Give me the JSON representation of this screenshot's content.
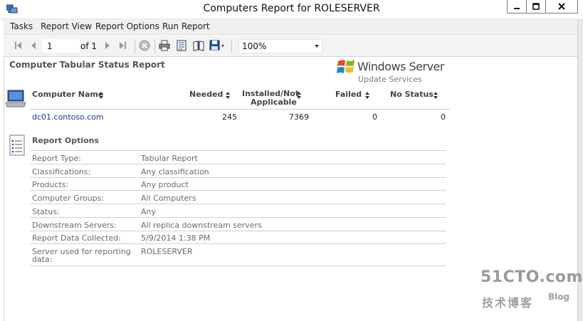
{
  "window": {
    "title": "Computers Report for ROLESERVER"
  },
  "menu": [
    "Tasks",
    "Report View",
    "Report Options",
    "Run Report"
  ],
  "toolbar": {
    "page_value": "1",
    "of_label": "of 1",
    "zoom": "100%"
  },
  "report": {
    "title": "Computer Tabular Status Report",
    "logo_line1": "Windows Server",
    "logo_line2": "Update Services",
    "columns": {
      "computer_name": "Computer Name",
      "needed": "Needed",
      "installed_line1": "Installed/Not",
      "installed_line2": "Applicable",
      "failed": "Failed",
      "no_status": "No Status"
    },
    "rows": [
      {
        "computer": "dc01.contoso.com",
        "needed": "245",
        "installed": "7369",
        "failed": "0",
        "no_status": "0"
      }
    ]
  },
  "options": {
    "title": "Report Options",
    "items": [
      {
        "label": "Report Type:",
        "value": "Tabular Report"
      },
      {
        "label": "Classifications:",
        "value": "Any classification"
      },
      {
        "label": "Products:",
        "value": "Any product"
      },
      {
        "label": "Computer Groups:",
        "value": "All Computers"
      },
      {
        "label": "Status:",
        "value": "Any"
      },
      {
        "label": "Downstream Servers:",
        "value": "All replica downstream servers"
      },
      {
        "label": "Report Data Collected:",
        "value": "5/9/2014 1:38 PM"
      },
      {
        "label_line1": "Server used for reporting",
        "label_line2": "data:",
        "value": "ROLESERVER"
      }
    ]
  },
  "watermark": {
    "line1": "51CTO.com",
    "line2": "技术博客",
    "blog": "Blog"
  },
  "colors": {
    "link": "#1a3a9a",
    "accent_blue": "#1f4fa0"
  }
}
